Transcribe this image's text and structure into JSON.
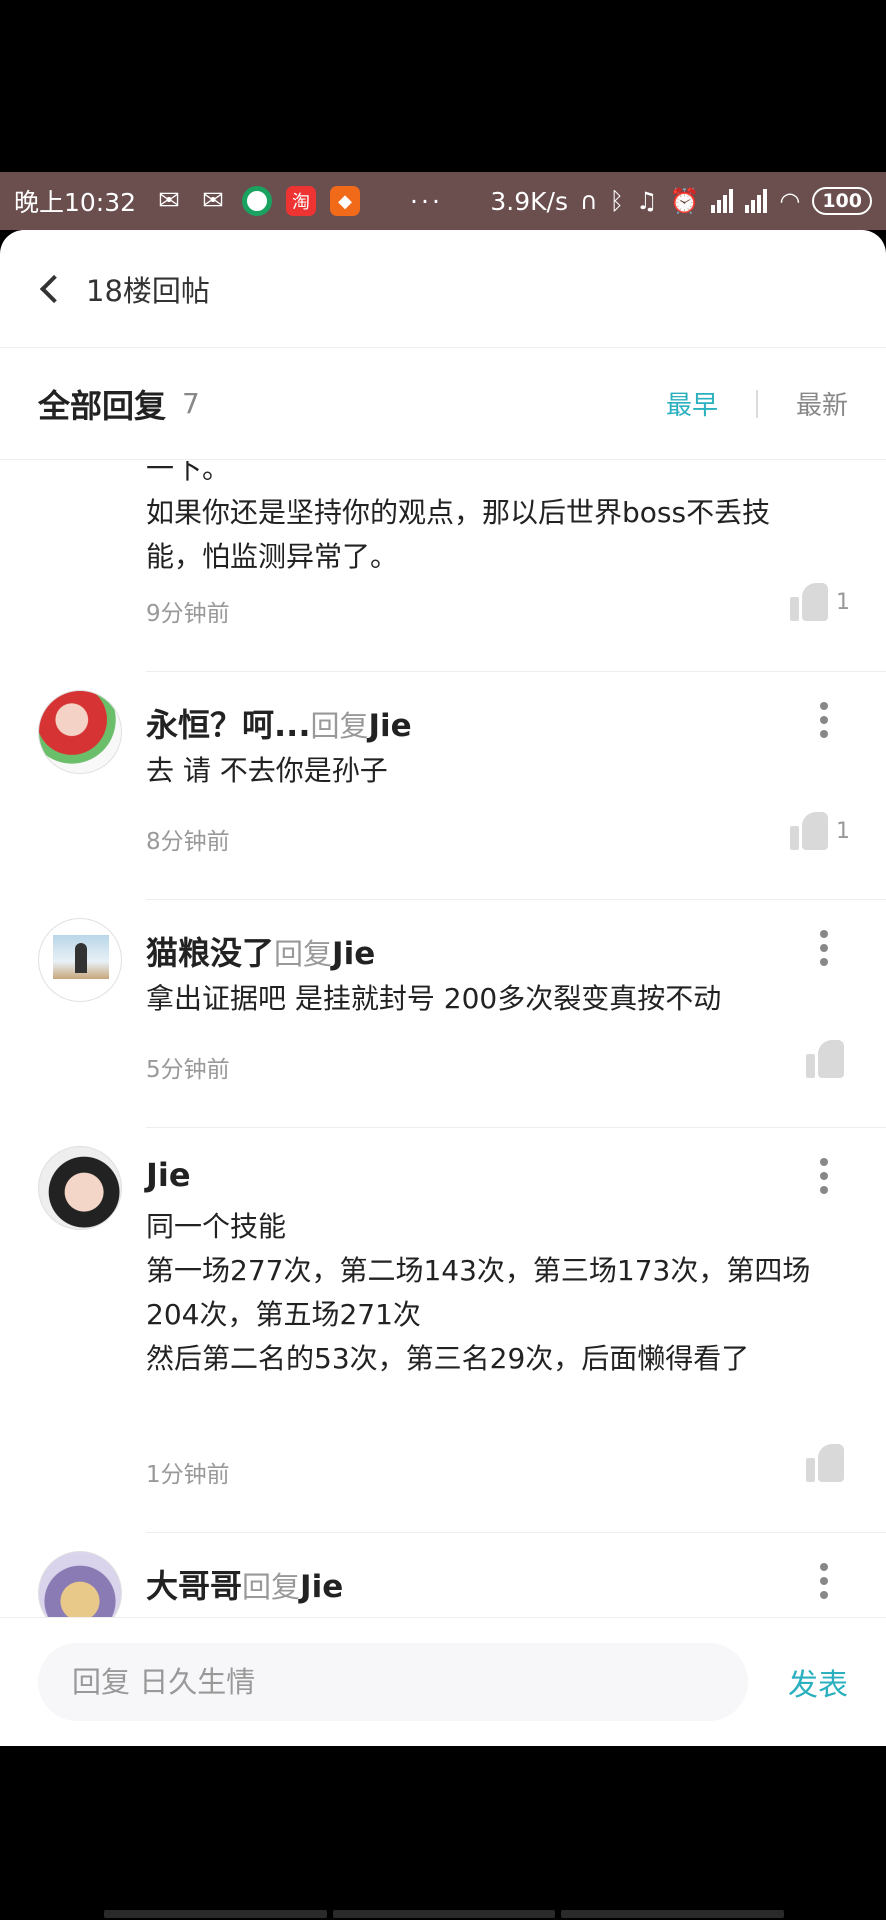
{
  "status_bar": {
    "time": "晚上10:32",
    "dots": "···",
    "speed": "3.9K/s",
    "battery": "100",
    "icons": [
      "wechat-icon",
      "wechat-icon",
      "app-ring-icon",
      "taobao-icon",
      "chick-app-icon",
      "headphones-icon",
      "bluetooth-icon",
      "mute-icon",
      "alarm-icon",
      "hd-signal-icon",
      "signal-icon",
      "wifi-icon",
      "battery-icon"
    ]
  },
  "header": {
    "title": "18楼回帖"
  },
  "replies_header": {
    "title": "全部回复",
    "count": "7",
    "sort_early": "最早",
    "sort_new": "最新"
  },
  "comments": [
    {
      "text_lines": [
        "一下。",
        "如果你还是坚持你的观点，那以后世界boss不丢技",
        "能，怕监测异常了。"
      ],
      "time": "9分钟前",
      "likes": "1"
    },
    {
      "user": "永恒？呵...",
      "reply_word": "回复",
      "reply_to": "Jie",
      "text_lines": [
        "去 请 不去你是孙子"
      ],
      "time": "8分钟前",
      "likes": "1"
    },
    {
      "user": "猫粮没了",
      "reply_word": "回复",
      "reply_to": "Jie",
      "text_lines": [
        "拿出证据吧  是挂就封号   200多次裂变真按不动"
      ],
      "time": "5分钟前",
      "likes": ""
    },
    {
      "user": "Jie",
      "text_lines": [
        "同一个技能",
        "第一场277次，第二场143次，第三场173次，第四场",
        "204次，第五场271次",
        "然后第二名的53次，第三名29次，后面懒得看了"
      ],
      "time": "1分钟前",
      "likes": ""
    },
    {
      "user": "大哥哥",
      "reply_word": "回复",
      "reply_to": "Jie"
    }
  ],
  "reply_bar": {
    "placeholder": "回复 日久生情",
    "send": "发表"
  },
  "colors": {
    "accent": "#2ab0bf",
    "status_bar": "#6b4f4f"
  }
}
